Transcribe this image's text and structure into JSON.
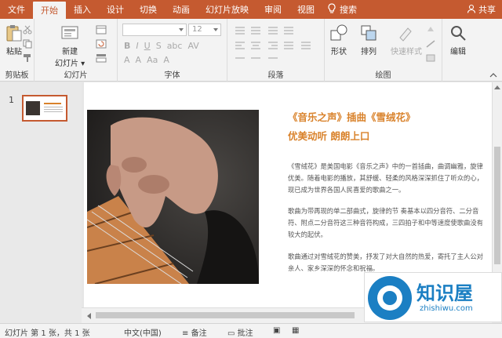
{
  "menu": {
    "tabs": [
      "文件",
      "开始",
      "插入",
      "设计",
      "切换",
      "动画",
      "幻灯片放映",
      "审阅",
      "视图"
    ],
    "active_tab": "开始",
    "search": "搜索",
    "share": "共享"
  },
  "ribbon": {
    "clipboard": {
      "paste": "粘贴",
      "label": "剪贴板"
    },
    "slides": {
      "new_slide": "新建",
      "new_slide2": "幻灯片 ▾",
      "label": "幻灯片"
    },
    "font": {
      "size": "12",
      "label": "字体"
    },
    "paragraph": {
      "label": "段落"
    },
    "drawing": {
      "shapes": "形状",
      "arrange": "排列",
      "quick_styles": "快速样式",
      "label": "绘图"
    },
    "editing": {
      "edit": "编辑"
    }
  },
  "thumbnails": {
    "slide_number": "1"
  },
  "slide": {
    "title_line1": "《音乐之声》插曲《雪绒花》",
    "title_line2": "优美动听 朗朗上口",
    "para1": "《雪绒花》是美国电影《音乐之声》中的一首插曲，曲调幽雅，旋律优美。随着电影的播放，其舒缓、轻柔的风格深深抓住了听众的心，现已成为世界各国人民喜爱的歌曲之一。",
    "para2": "歌曲为带再现的单二部曲式，旋律的节 奏基本以四分音符、二分音符、附点二分音符这三种音符构成，三四拍子和中等速度使歌曲没有较大的起伏。",
    "para3": "歌曲通过对雪绒花的赞美，抒发了对大自然的热爱，寄托了主人公对亲人、家乡深深的怀念和祝福。"
  },
  "status": {
    "slide_info": "幻灯片 第 1 张，共 1 张",
    "language": "中文(中国)",
    "notes": "备注",
    "comments": "批注"
  },
  "watermark": {
    "brand": "知识屋",
    "url": "zhishiwu.com"
  },
  "colors": {
    "accent": "#c55a30",
    "title": "#d9822b",
    "brand_blue": "#1b7fc3"
  }
}
